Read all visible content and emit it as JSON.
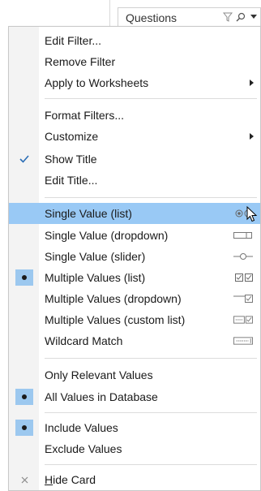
{
  "card": {
    "title": "Questions",
    "filter_icon": "filter-icon",
    "search_icon": "search-icon",
    "dropdown_icon": "dropdown-arrow-icon"
  },
  "menu": {
    "edit_filter": "Edit Filter...",
    "remove_filter": "Remove Filter",
    "apply_to_worksheets": "Apply to Worksheets",
    "format_filters": "Format Filters...",
    "customize": "Customize",
    "show_title": "Show Title",
    "edit_title": "Edit Title...",
    "single_value_list": "Single Value (list)",
    "single_value_dropdown": "Single Value (dropdown)",
    "single_value_slider": "Single Value (slider)",
    "multiple_values_list": "Multiple Values (list)",
    "multiple_values_dropdown": "Multiple Values (dropdown)",
    "multiple_values_custom_list": "Multiple Values (custom list)",
    "wildcard_match": "Wildcard Match",
    "only_relevant_values": "Only Relevant Values",
    "all_values_in_database": "All Values in Database",
    "include_values": "Include Values",
    "exclude_values": "Exclude Values",
    "hide_card_prefix": "H",
    "hide_card_rest": "ide Card"
  },
  "state": {
    "highlighted_item": "Single Value (list)",
    "show_title_checked": true,
    "multiple_values_list_selected": true,
    "all_values_in_database_selected": true,
    "include_values_selected": true
  },
  "colors": {
    "highlight": "#99c9f5",
    "check_bg": "#9cc8ef",
    "check_mark": "#2a6db5"
  }
}
